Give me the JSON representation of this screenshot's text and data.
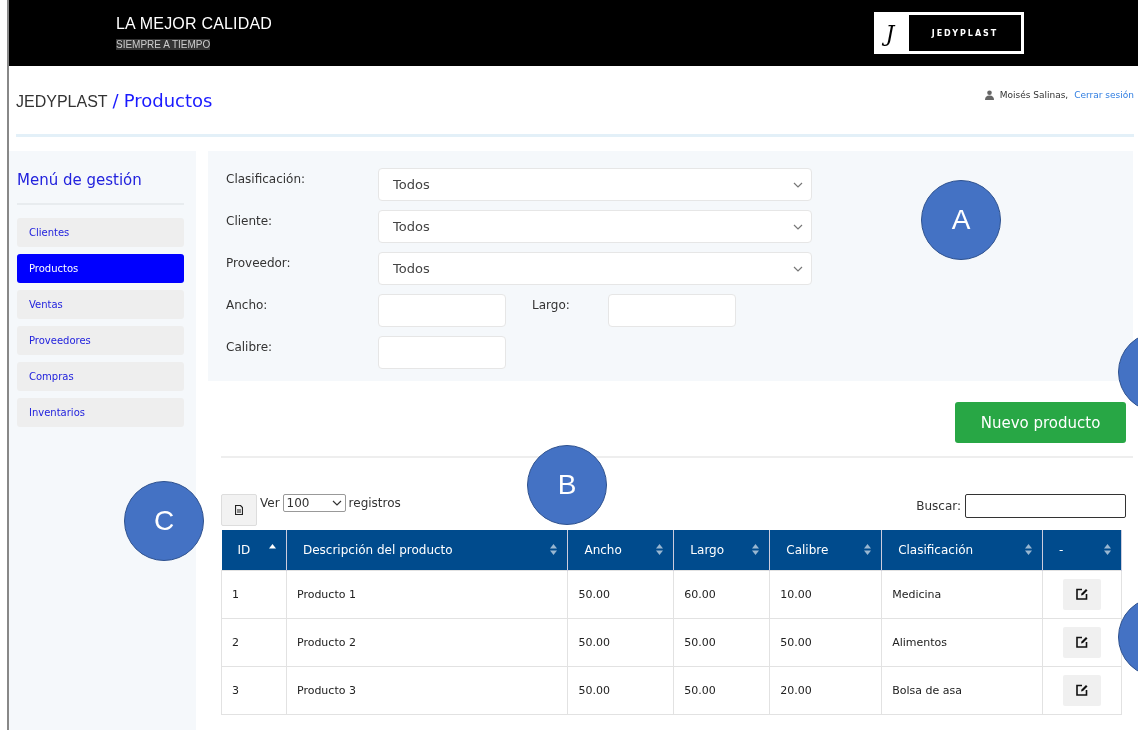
{
  "top_bar": {
    "slogan": "LA MEJOR CALIDAD",
    "tagline": "SIEMPRE A TIEMPO",
    "logo": {
      "mark": "J",
      "name": "JEDYPLAST"
    }
  },
  "breadcrumb": {
    "root": "JEDYPLAST",
    "separator": "/",
    "current": "Productos"
  },
  "user": {
    "name": "Moisés Salinas,",
    "logout": "Cerrar sesión"
  },
  "sidebar": {
    "title": "Menú de gestión",
    "items": [
      {
        "label": "Clientes",
        "selected": false
      },
      {
        "label": "Productos",
        "selected": true
      },
      {
        "label": "Ventas",
        "selected": false
      },
      {
        "label": "Proveedores",
        "selected": false
      },
      {
        "label": "Compras",
        "selected": false
      },
      {
        "label": "Inventarios",
        "selected": false
      }
    ]
  },
  "filters": {
    "selects": [
      {
        "label": "Clasificación:",
        "value": "Todos"
      },
      {
        "label": "Cliente:",
        "value": "Todos"
      },
      {
        "label": "Proveedor:",
        "value": "Todos"
      }
    ],
    "ancho": {
      "label": "Ancho:"
    },
    "largo": {
      "label": "Largo:"
    },
    "calibre": {
      "label": "Calibre:"
    }
  },
  "new_button": "Nuevo producto",
  "table_controls": {
    "show_label": "Ver",
    "page_size": "100",
    "records_label": "registros",
    "search_label": "Buscar:"
  },
  "table": {
    "columns": [
      {
        "label": "ID",
        "sorted": true
      },
      {
        "label": "Descripción del producto",
        "sorted": false
      },
      {
        "label": "Ancho",
        "sorted": false
      },
      {
        "label": "Largo",
        "sorted": false
      },
      {
        "label": "Calibre",
        "sorted": false
      },
      {
        "label": "Clasificación",
        "sorted": false
      },
      {
        "label": "-",
        "sorted": false
      }
    ],
    "rows": [
      [
        "1",
        "Producto 1",
        "50.00",
        "60.00",
        "10.00",
        "Medicina"
      ],
      [
        "2",
        "Producto 2",
        "50.00",
        "50.00",
        "50.00",
        "Alimentos"
      ],
      [
        "3",
        "Producto 3",
        "50.00",
        "50.00",
        "20.00",
        "Bolsa de asa"
      ]
    ]
  },
  "callouts": [
    {
      "kind": "full",
      "label": "A"
    },
    {
      "kind": "full",
      "label": "B"
    },
    {
      "kind": "full",
      "label": "C"
    },
    {
      "kind": "partial"
    },
    {
      "kind": "partial"
    }
  ]
}
